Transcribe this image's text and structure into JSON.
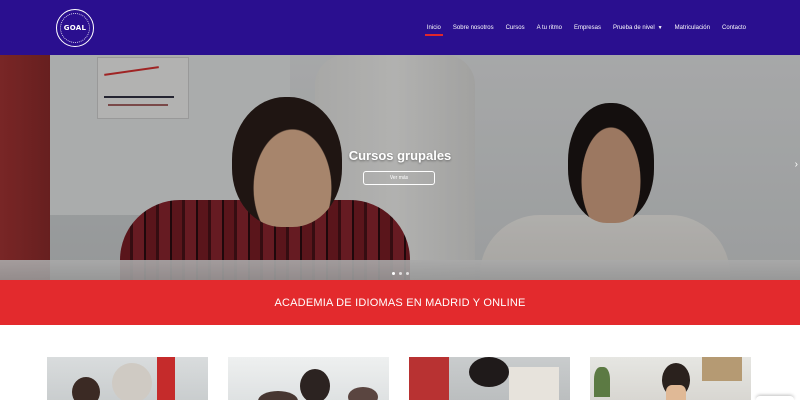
{
  "brand": {
    "logo_text": "GOAL"
  },
  "nav": {
    "items": [
      {
        "label": "Inicio",
        "active": true
      },
      {
        "label": "Sobre nosotros"
      },
      {
        "label": "Cursos"
      },
      {
        "label": "A tu ritmo"
      },
      {
        "label": "Empresas"
      },
      {
        "label": "Prueba de nivel",
        "has_dropdown": true
      },
      {
        "label": "Matriculación"
      },
      {
        "label": "Contacto"
      }
    ]
  },
  "hero": {
    "title": "Cursos grupales",
    "button_label": "Ver más",
    "next_arrow": "›",
    "slides": 3,
    "active_slide": 1
  },
  "banner": {
    "text": "ACADEMIA DE IDIOMAS EN MADRID Y ONLINE"
  },
  "colors": {
    "header_bg": "#2a0f8f",
    "banner_bg": "#e32a2d",
    "active_underline": "#e0262b"
  }
}
